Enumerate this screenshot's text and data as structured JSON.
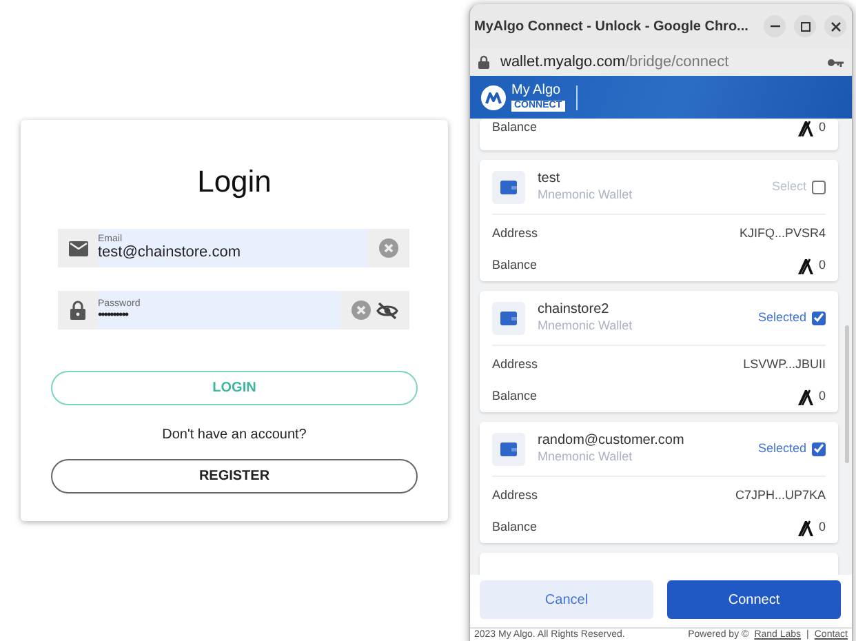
{
  "login": {
    "title": "Login",
    "email": {
      "label": "Email",
      "value": "test@chainstore.com"
    },
    "password": {
      "label": "Password",
      "value": "••••••••••"
    },
    "login_button": "LOGIN",
    "prompt": "Don't have an account?",
    "register_button": "REGISTER"
  },
  "popup": {
    "window_title": "MyAlgo Connect - Unlock - Google Chro...",
    "url_host": "wallet.myalgo.com",
    "url_path": "/bridge/connect",
    "brand": {
      "name": "My Algo",
      "tag": "CONNECT"
    },
    "wallets": [
      {
        "kind": "partial",
        "balance_label": "Balance",
        "balance": "0"
      },
      {
        "kind": "full",
        "name": "test",
        "type": "Mnemonic Wallet",
        "select_label": "Select",
        "selected": false,
        "address_label": "Address",
        "address": "KJIFQ...PVSR4",
        "balance_label": "Balance",
        "balance": "0"
      },
      {
        "kind": "full",
        "name": "chainstore2",
        "type": "Mnemonic Wallet",
        "select_label": "Selected",
        "selected": true,
        "address_label": "Address",
        "address": "LSVWP...JBUII",
        "balance_label": "Balance",
        "balance": "0"
      },
      {
        "kind": "full",
        "name": "random@customer.com",
        "type": "Mnemonic Wallet",
        "select_label": "Selected",
        "selected": true,
        "address_label": "Address",
        "address": "C7JPH...UP7KA",
        "balance_label": "Balance",
        "balance": "0"
      }
    ],
    "cancel_button": "Cancel",
    "connect_button": "Connect",
    "footer": {
      "copyright": "2023 My Algo. All Rights Reserved.",
      "powered": "Powered by ©",
      "link": "Rand Labs",
      "separator": "|",
      "contact": "Contact"
    }
  }
}
